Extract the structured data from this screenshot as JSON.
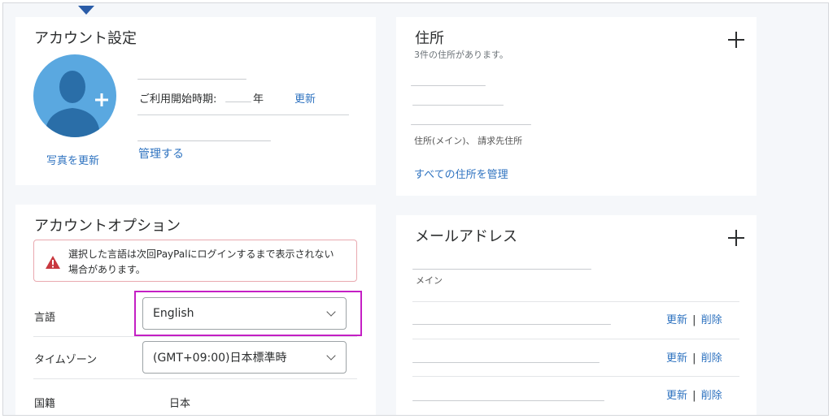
{
  "account_settings": {
    "title": "アカウント設定",
    "photo_link": "写真を更新",
    "start_label": "ご利用開始時期:",
    "year_suffix": "年",
    "update_link": "更新",
    "manage_link": "管理する"
  },
  "address": {
    "title": "住所",
    "subtitle": "3件の住所があります。",
    "type_label": "住所(メイン)、 請求先住所",
    "manage_all_link": "すべての住所を管理"
  },
  "account_options": {
    "title": "アカウントオプション",
    "alert_text_1": "選択した言語は次回PayPalにログインするまで表示されない",
    "alert_text_2": "場合があります。",
    "language_label": "言語",
    "language_value": "English",
    "timezone_label": "タイムゾーン",
    "timezone_value": "(GMT+09:00)日本標準時",
    "nationality_label": "国籍",
    "nationality_value": "日本"
  },
  "email": {
    "title": "メールアドレス",
    "main_label": "メイン",
    "rows": [
      {
        "update": "更新",
        "divider": "|",
        "delete": "削除"
      },
      {
        "update": "更新",
        "divider": "|",
        "delete": "削除"
      },
      {
        "update": "更新",
        "divider": "|",
        "delete": "削除"
      }
    ]
  },
  "colors": {
    "link": "#2f73c0",
    "highlight": "#c41fc4",
    "alert_icon": "#c8383f",
    "avatar_bg": "#5aa8e0",
    "avatar_figure": "#2a6ea8"
  }
}
